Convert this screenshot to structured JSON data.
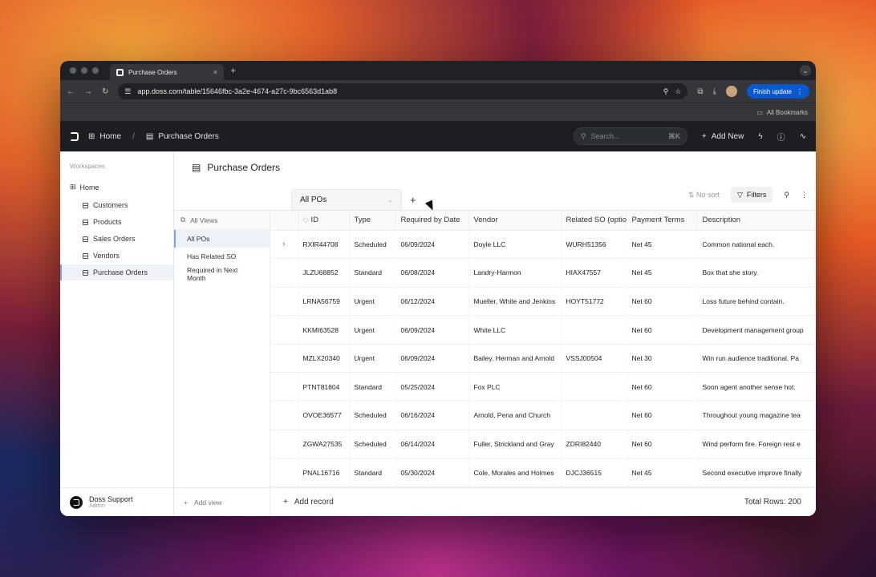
{
  "browser": {
    "tab_title": "Purchase Orders",
    "tab_close": "×",
    "new_tab": "+",
    "url": "app.doss.com/table/15646fbc-3a2e-4674-a27c-9bc6563d1ab8",
    "finish_update": "Finish update",
    "bookmarks": "All Bookmarks"
  },
  "header": {
    "home": "Home",
    "separator": "/",
    "current": "Purchase Orders",
    "search_placeholder": "Search...",
    "search_shortcut": "⌘K",
    "add_new": "Add New"
  },
  "sidebar": {
    "section": "Workspaces",
    "home": "Home",
    "items": [
      {
        "label": "Customers"
      },
      {
        "label": "Products"
      },
      {
        "label": "Sales Orders"
      },
      {
        "label": "Vendors"
      },
      {
        "label": "Purchase Orders",
        "active": true
      }
    ],
    "user_name": "Doss Support",
    "user_role": "Admin"
  },
  "page": {
    "title": "Purchase Orders",
    "active_view": "All POs",
    "no_sort": "No sort",
    "filters": "Filters"
  },
  "views_panel": {
    "header": "All Views",
    "items": [
      "All POs",
      "Has Related SO",
      "Required in Next Month"
    ],
    "add_view": "Add view"
  },
  "table": {
    "columns": [
      "ID",
      "Type",
      "Required by Date",
      "Vendor",
      "Related SO (optio",
      "Payment Terms",
      "Description"
    ],
    "rows": [
      [
        "RXIR44708",
        "Scheduled",
        "06/09/2024",
        "Doyle LLC",
        "WURH51356",
        "Net 45",
        "Common national each."
      ],
      [
        "JLZU68852",
        "Standard",
        "06/08/2024",
        "Landry-Harmon",
        "HIAX47557",
        "Net 45",
        "Box that she story."
      ],
      [
        "LRNA56759",
        "Urgent",
        "06/12/2024",
        "Mueller, White and Jenkins",
        "HOYT51772",
        "Net 60",
        "Loss future behind contain."
      ],
      [
        "KKMI63528",
        "Urgent",
        "06/09/2024",
        "White LLC",
        "",
        "Net 60",
        "Development management group"
      ],
      [
        "MZLX20340",
        "Urgent",
        "06/09/2024",
        "Bailey, Herman and Arnold",
        "VSSJ00504",
        "Net 30",
        "Win run audience traditional. Pa"
      ],
      [
        "PTNT81804",
        "Standard",
        "05/25/2024",
        "Fox PLC",
        "",
        "Net 60",
        "Soon agent another sense hot."
      ],
      [
        "OVOE36577",
        "Scheduled",
        "06/16/2024",
        "Arnold, Pena and Church",
        "",
        "Net 60",
        "Throughout young magazine tea"
      ],
      [
        "ZGWA27535",
        "Scheduled",
        "06/14/2024",
        "Fuller, Strickland and Gray",
        "ZDRI82440",
        "Net 60",
        "Wind perform fire. Foreign rest e"
      ],
      [
        "PNAL16716",
        "Standard",
        "05/30/2024",
        "Cole, Morales and Holmes",
        "DJCJ36515",
        "Net 45",
        "Second executive improve finally"
      ]
    ],
    "add_record": "Add record",
    "total_rows": "Total Rows: 200"
  }
}
